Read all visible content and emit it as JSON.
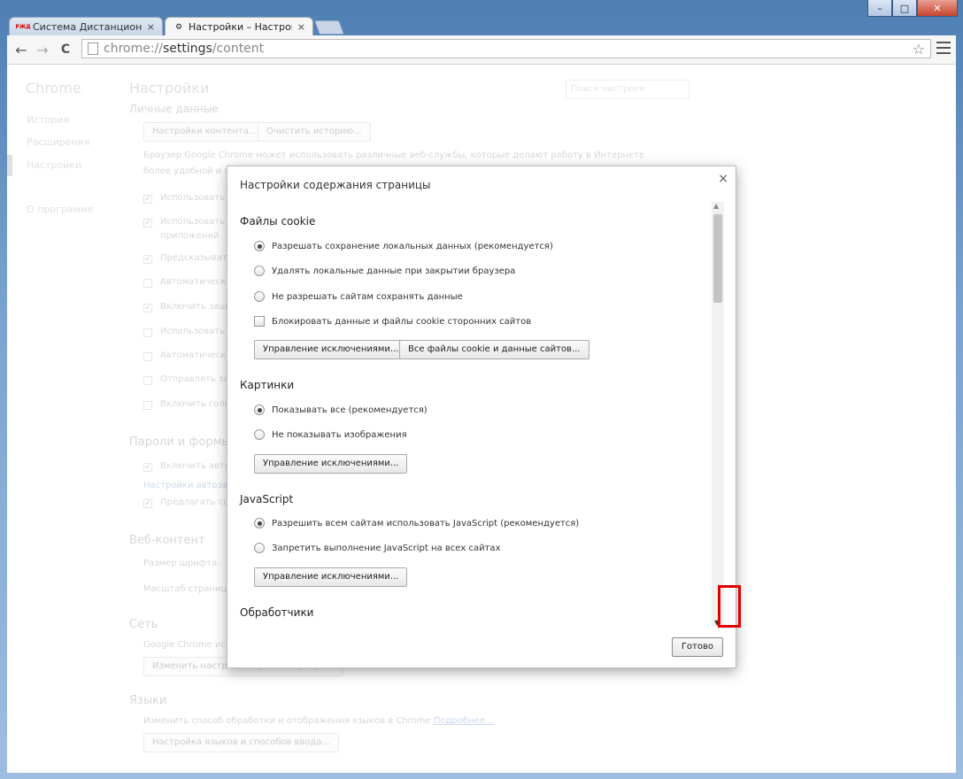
{
  "window": {
    "minimize_label": "–",
    "maximize_label": "□",
    "close_label": "✕"
  },
  "tabs": [
    {
      "favicon_text": "РЖД",
      "title": "Система Дистанционног",
      "close": "×",
      "active": false
    },
    {
      "favicon_text": "⚙",
      "title": "Настройки – Настройки с",
      "close": "×",
      "active": true
    }
  ],
  "toolbar": {
    "back": "←",
    "forward": "→",
    "reload": "C",
    "url_scheme": "chrome://",
    "url_host": "settings",
    "url_path": "/content",
    "star": "☆"
  },
  "background_page": {
    "brand": "Chrome",
    "sidebar": [
      "История",
      "Расширения",
      "Настройки",
      "О программе"
    ],
    "title": "Настройки",
    "search_placeholder": "Поиск настроек",
    "personal": {
      "heading": "Личные данные",
      "content_settings_btn": "Настройки контента...",
      "clear_history_btn": "Очистить историю...",
      "desc1": "Браузер Google Chrome может использовать различные веб-службы, которые делают работу в Интернете",
      "desc2": "более удобной и п",
      "checks": [
        {
          "label": "Использовать в",
          "checked": true
        },
        {
          "label": "Использовать п",
          "checked": true
        },
        {
          "label": "приложений",
          "checked": false
        },
        {
          "label": "Предсказывать",
          "checked": true
        },
        {
          "label": "Автоматически",
          "checked": false
        },
        {
          "label": "Включить защи",
          "checked": true
        },
        {
          "label": "Использовать в",
          "checked": false
        },
        {
          "label": "Автоматически",
          "checked": false
        },
        {
          "label": "Отправлять зап",
          "checked": false
        },
        {
          "label": "Включить голо",
          "checked": false
        }
      ]
    },
    "passwords": {
      "heading": "Пароли и формы",
      "autofill_check": "Включить авто",
      "autofill_link": "Настройки автоза",
      "offer_check": "Предлагать сох"
    },
    "web_content": {
      "heading": "Веб-контент",
      "font_size": "Размер шрифта:",
      "page_zoom": "Масштаб страниц"
    },
    "network": {
      "heading": "Сеть",
      "text": "Google Chrome испо",
      "proxy_btn": "Изменить настройки прокси-сервера..."
    },
    "languages": {
      "heading": "Языки",
      "text": "Изменить способ обработки и отображения языков в Chrome",
      "more_link": "Подробнее...",
      "lang_btn": "Настройка языков и способов ввода..."
    }
  },
  "dialog": {
    "title": "Настройки содержания страницы",
    "close": "×",
    "cookies": {
      "heading": "Файлы cookie",
      "options": [
        "Разрешать сохранение локальных данных (рекомендуется)",
        "Удалять локальные данные при закрытии браузера",
        "Не разрешать сайтам сохранять данные"
      ],
      "selected": 0,
      "block_third_party": "Блокировать данные и файлы cookie сторонних сайтов",
      "manage_exceptions": "Управление исключениями...",
      "all_cookies": "Все файлы cookie и данные сайтов..."
    },
    "images": {
      "heading": "Картинки",
      "options": [
        "Показывать все (рекомендуется)",
        "Не показывать изображения"
      ],
      "selected": 0,
      "manage_exceptions": "Управление исключениями..."
    },
    "javascript": {
      "heading": "JavaScript",
      "options": [
        "Разрешить всем сайтам использовать JavaScript (рекомендуется)",
        "Запретить выполнение JavaScript на всех сайтах"
      ],
      "selected": 0,
      "manage_exceptions": "Управление исключениями..."
    },
    "handlers": {
      "heading": "Обработчики"
    },
    "scroll_up": "▲",
    "scroll_down": "▼",
    "done": "Готово"
  }
}
